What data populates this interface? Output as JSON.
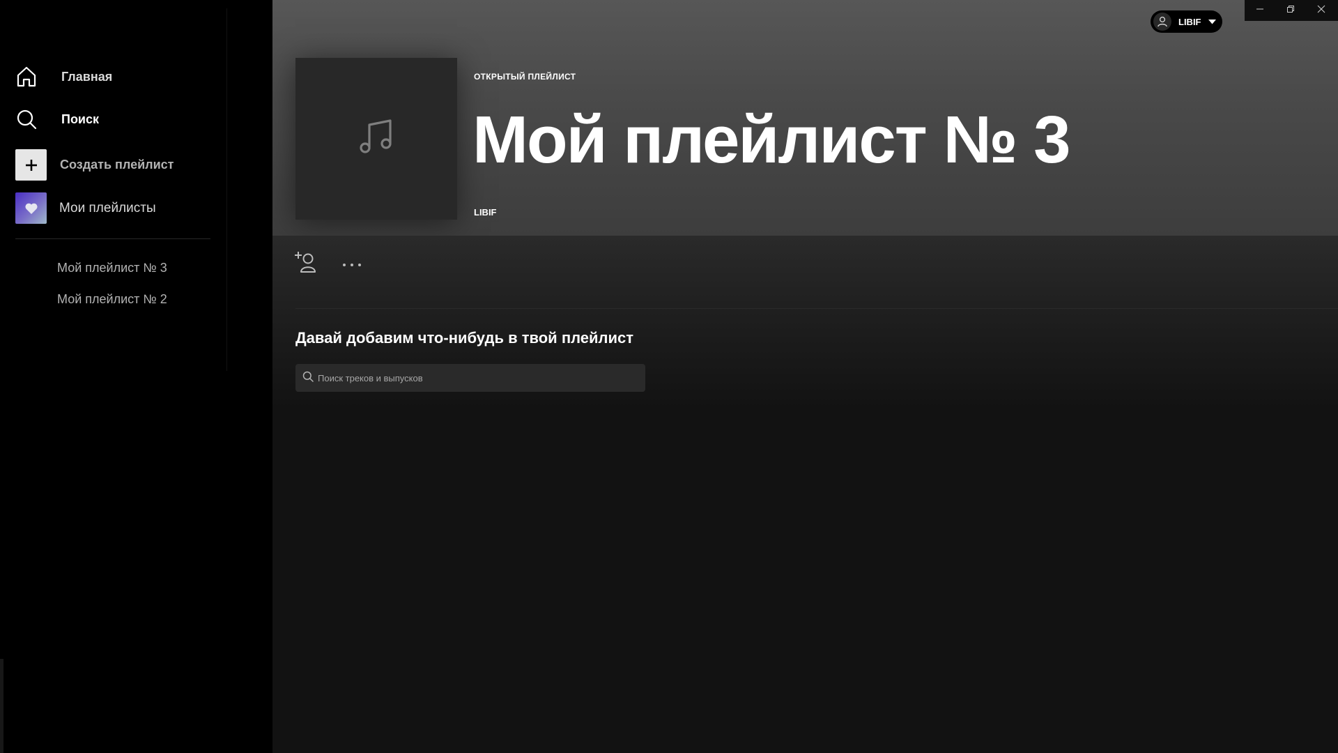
{
  "sidebar": {
    "home_label": "Главная",
    "search_label": "Поиск",
    "create_label": "Создать плейлист",
    "liked_label": "Мои плейлисты",
    "playlists": [
      "Мой плейлист № 3",
      "Мой плейлист № 2"
    ]
  },
  "header": {
    "user_name": "LIBIF"
  },
  "playlist": {
    "type": "ОТКРЫТЫЙ ПЛЕЙЛИСТ",
    "title": "Мой плейлист № 3",
    "owner": "LIBIF"
  },
  "content": {
    "heading": "Давай добавим что-нибудь в твой плейлист",
    "search_placeholder": "Поиск треков и выпусков"
  },
  "colors": {
    "background": "#121212",
    "sidebar": "#000000",
    "hero": "#535353",
    "text": "#ffffff",
    "muted": "#b3b3b3"
  }
}
